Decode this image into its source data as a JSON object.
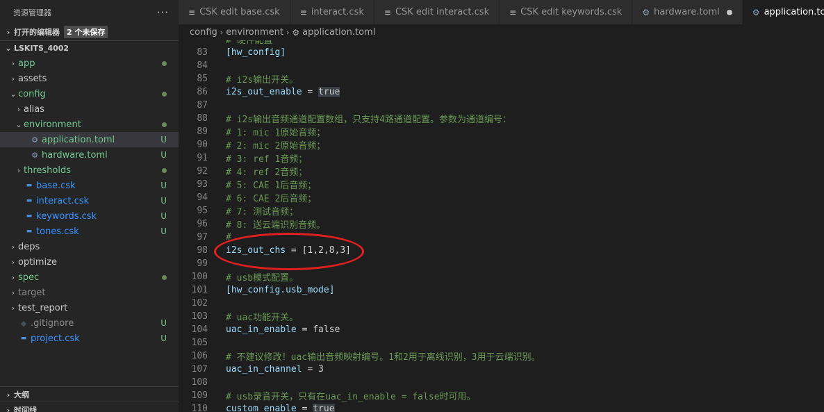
{
  "explorer": {
    "title": "资源管理器",
    "more": "···",
    "open_editors": {
      "label": "打开的编辑器",
      "badge": "2 个未保存"
    },
    "workspace": {
      "label": "LSKITS_4002"
    },
    "tree": [
      {
        "label": "app",
        "chev": "›",
        "indent": 0,
        "color": "c-mod",
        "dec": "dot"
      },
      {
        "label": "assets",
        "chev": "›",
        "indent": 0,
        "color": "",
        "dec": ""
      },
      {
        "label": "config",
        "chev": "⌄",
        "indent": 0,
        "color": "c-mod",
        "dec": "dot"
      },
      {
        "label": "alias",
        "chev": "›",
        "indent": 1,
        "color": "",
        "dec": ""
      },
      {
        "label": "environment",
        "chev": "⌄",
        "indent": 1,
        "color": "c-mod",
        "dec": "dot"
      },
      {
        "label": "application.toml",
        "chev": "",
        "indent": 2,
        "color": "c-mod",
        "dec": "U",
        "icon": "gear",
        "selected": true
      },
      {
        "label": "hardware.toml",
        "chev": "",
        "indent": 2,
        "color": "c-mod",
        "dec": "U",
        "icon": "gear"
      },
      {
        "label": "thresholds",
        "chev": "›",
        "indent": 1,
        "color": "c-mod",
        "dec": "dot"
      },
      {
        "label": "base.csk",
        "chev": "",
        "indent": 1,
        "color": "c-new",
        "dec": "U",
        "icon": "file"
      },
      {
        "label": "interact.csk",
        "chev": "",
        "indent": 1,
        "color": "c-new",
        "dec": "U",
        "icon": "file"
      },
      {
        "label": "keywords.csk",
        "chev": "",
        "indent": 1,
        "color": "c-new",
        "dec": "U",
        "icon": "file"
      },
      {
        "label": "tones.csk",
        "chev": "",
        "indent": 1,
        "color": "c-new",
        "dec": "U",
        "icon": "file"
      },
      {
        "label": "deps",
        "chev": "›",
        "indent": 0,
        "color": "",
        "dec": ""
      },
      {
        "label": "optimize",
        "chev": "›",
        "indent": 0,
        "color": "",
        "dec": ""
      },
      {
        "label": "spec",
        "chev": "›",
        "indent": 0,
        "color": "c-mod",
        "dec": "dot"
      },
      {
        "label": "target",
        "chev": "›",
        "indent": 0,
        "color": "c-dim",
        "dec": ""
      },
      {
        "label": "test_report",
        "chev": "›",
        "indent": 0,
        "color": "",
        "dec": ""
      },
      {
        "label": ".gitignore",
        "chev": "",
        "indent": 0,
        "color": "c-git",
        "dec": "U",
        "icon": "git"
      },
      {
        "label": "project.csk",
        "chev": "",
        "indent": 0,
        "color": "c-new",
        "dec": "U",
        "icon": "file"
      }
    ],
    "outline": "大纲",
    "timeline": "时间线"
  },
  "tabs": [
    {
      "label": "CSK edit base.csk",
      "icon": "file",
      "active": false,
      "dirty": false
    },
    {
      "label": "interact.csk",
      "icon": "file",
      "active": false,
      "dirty": false
    },
    {
      "label": "CSK edit interact.csk",
      "icon": "file",
      "active": false,
      "dirty": false
    },
    {
      "label": "CSK edit keywords.csk",
      "icon": "file",
      "active": false,
      "dirty": false
    },
    {
      "label": "hardware.toml",
      "icon": "gear",
      "active": false,
      "dirty": true
    },
    {
      "label": "application.toml",
      "icon": "gear",
      "active": true,
      "dirty": false
    }
  ],
  "breadcrumb": {
    "parts": [
      "config",
      "environment",
      "application.toml"
    ]
  },
  "editor": {
    "partial_top": "# 硬件配置",
    "lines": [
      {
        "n": "83",
        "code": [
          [
            "kw",
            "[hw_config]"
          ]
        ]
      },
      {
        "n": "84",
        "code": []
      },
      {
        "n": "85",
        "code": [
          [
            "cm",
            "# i2s输出开关。"
          ]
        ]
      },
      {
        "n": "86",
        "code": [
          [
            "kw",
            "i2s_out_enable"
          ],
          [
            "op",
            " = "
          ],
          [
            "hl",
            "true"
          ]
        ]
      },
      {
        "n": "87",
        "code": []
      },
      {
        "n": "88",
        "code": [
          [
            "cm",
            "# i2s输出音频通道配置数组，只支持4路通道配置。参数为通道编号："
          ]
        ]
      },
      {
        "n": "89",
        "code": [
          [
            "cm",
            "# 1: mic 1原始音频；"
          ]
        ]
      },
      {
        "n": "90",
        "code": [
          [
            "cm",
            "# 2: mic 2原始音频；"
          ]
        ]
      },
      {
        "n": "91",
        "code": [
          [
            "cm",
            "# 3: ref 1音频；"
          ]
        ]
      },
      {
        "n": "92",
        "code": [
          [
            "cm",
            "# 4: ref 2音频；"
          ]
        ]
      },
      {
        "n": "93",
        "code": [
          [
            "cm",
            "# 5: CAE 1后音频；"
          ]
        ]
      },
      {
        "n": "94",
        "code": [
          [
            "cm",
            "# 6: CAE 2后音频；"
          ]
        ]
      },
      {
        "n": "95",
        "code": [
          [
            "cm",
            "# 7: 测试音频；"
          ]
        ]
      },
      {
        "n": "96",
        "code": [
          [
            "cm",
            "# 8: 送云端识别音频。"
          ]
        ]
      },
      {
        "n": "97",
        "code": [
          [
            "cm",
            "#"
          ]
        ]
      },
      {
        "n": "98",
        "code": [
          [
            "kw",
            "i2s_out_chs"
          ],
          [
            "op",
            " = [1,2,8,3]"
          ]
        ]
      },
      {
        "n": "99",
        "code": []
      },
      {
        "n": "100",
        "code": [
          [
            "cm",
            "# usb模式配置。"
          ]
        ]
      },
      {
        "n": "101",
        "code": [
          [
            "kw",
            "[hw_config.usb_mode]"
          ]
        ]
      },
      {
        "n": "102",
        "code": []
      },
      {
        "n": "103",
        "code": [
          [
            "cm",
            "# uac功能开关。"
          ]
        ]
      },
      {
        "n": "104",
        "code": [
          [
            "kw",
            "uac_in_enable"
          ],
          [
            "op",
            " = false"
          ]
        ]
      },
      {
        "n": "105",
        "code": []
      },
      {
        "n": "106",
        "code": [
          [
            "cm",
            "# 不建议修改！uac输出音频映射编号。1和2用于离线识别，3用于云端识别。"
          ]
        ]
      },
      {
        "n": "107",
        "code": [
          [
            "kw",
            "uac_in_channel"
          ],
          [
            "op",
            " = 3"
          ]
        ]
      },
      {
        "n": "108",
        "code": []
      },
      {
        "n": "109",
        "code": [
          [
            "cm",
            "# usb录音开关，只有在uac_in_enable = false时可用。"
          ]
        ]
      },
      {
        "n": "110",
        "code": [
          [
            "kw",
            "custom_enable"
          ],
          [
            "op",
            " = "
          ],
          [
            "hl",
            "true"
          ]
        ]
      }
    ]
  }
}
